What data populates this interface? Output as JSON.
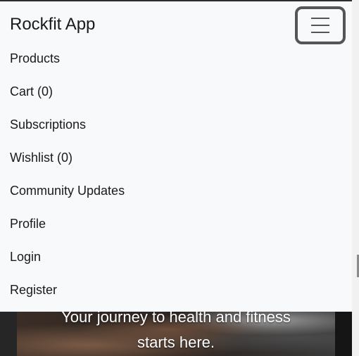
{
  "navbar": {
    "brand": "Rockfit App",
    "toggler_icon": "hamburger-icon",
    "items": [
      {
        "id": "products",
        "label": "Products"
      },
      {
        "id": "cart",
        "label": "Cart (0)"
      },
      {
        "id": "subscriptions",
        "label": "Subscriptions"
      },
      {
        "id": "wishlist",
        "label": "Wishlist (0)"
      },
      {
        "id": "community-updates",
        "label": "Community Updates"
      },
      {
        "id": "profile",
        "label": "Profile"
      },
      {
        "id": "login",
        "label": "Login"
      },
      {
        "id": "register",
        "label": "Register"
      }
    ]
  },
  "hero": {
    "tagline_line1": "Your journey to health and fitness",
    "tagline_line2": "starts here."
  }
}
